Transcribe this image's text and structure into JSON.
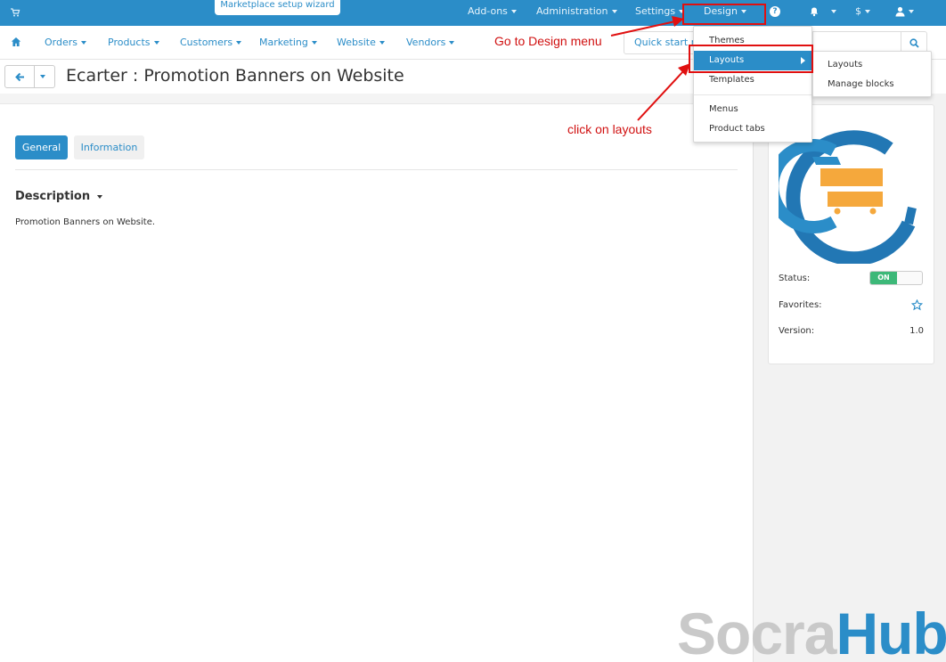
{
  "topbar": {
    "wizard_label": "Marketplace setup wizard",
    "items": [
      {
        "label": "Add-ons"
      },
      {
        "label": "Administration"
      },
      {
        "label": "Settings"
      },
      {
        "label": "Design"
      }
    ],
    "currency_label": "$"
  },
  "subnav": {
    "items": [
      {
        "label": "Orders"
      },
      {
        "label": "Products"
      },
      {
        "label": "Customers"
      },
      {
        "label": "Marketing"
      },
      {
        "label": "Website"
      },
      {
        "label": "Vendors"
      }
    ],
    "quick_start_label": "Quick start m"
  },
  "page": {
    "title": "Ecarter : Promotion Banners on Website"
  },
  "tabs": [
    {
      "label": "General"
    },
    {
      "label": "Information"
    }
  ],
  "description": {
    "heading": "Description",
    "text": "Promotion Banners on Website."
  },
  "design_menu": {
    "items": [
      {
        "label": "Themes"
      },
      {
        "label": "Layouts"
      },
      {
        "label": "Templates"
      },
      {
        "label": "Menus"
      },
      {
        "label": "Product tabs"
      }
    ]
  },
  "layouts_submenu": {
    "items": [
      {
        "label": "Layouts"
      },
      {
        "label": "Manage blocks"
      }
    ]
  },
  "sidebar": {
    "status_label": "Status:",
    "status_value": "ON",
    "favorites_label": "Favorites:",
    "version_label": "Version:",
    "version_value": "1.0"
  },
  "annotations": {
    "design_note": "Go to Design menu",
    "layouts_note": "click on layouts"
  },
  "watermark": {
    "part1": "Socra",
    "part2": "Hub"
  },
  "colors": {
    "primary": "#2b8dc8",
    "status_on": "#3cb878",
    "annotation": "#e01010",
    "logo_orange": "#f5a83c"
  },
  "icons": {
    "cart": "cart-icon",
    "home": "home-icon",
    "help": "help-icon",
    "bell": "bell-icon",
    "user": "user-icon",
    "search": "search-icon",
    "back": "arrow-left-icon",
    "star": "star-icon"
  }
}
